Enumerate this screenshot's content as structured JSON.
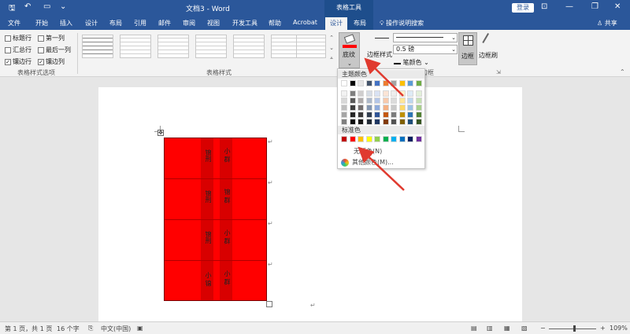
{
  "app": {
    "doc_title": "文档3 - Word",
    "context_title": "表格工具",
    "login_label": "登录",
    "share_label": "共享",
    "search_label": "操作说明搜索"
  },
  "tabs": [
    "文件",
    "开始",
    "插入",
    "设计",
    "布局",
    "引用",
    "邮件",
    "审阅",
    "视图",
    "开发工具",
    "帮助",
    "Acrobat",
    "设计",
    "布局"
  ],
  "style_options": {
    "header_row": "标题行",
    "first_col": "第一列",
    "total_row": "汇总行",
    "last_col": "最后一列",
    "banded_rows": "镶边行",
    "banded_cols": "镶边列",
    "group_label": "表格样式选项"
  },
  "table_styles": {
    "group_label": "表格样式"
  },
  "shading": {
    "label": "底纹",
    "color": "#ff0000"
  },
  "borders": {
    "border_styles_label": "边框样式",
    "line_weight": "0.5 磅",
    "pen_color_label": "笔颜色",
    "border_label": "边框",
    "painter_label": "边框刷",
    "group_label": "边框"
  },
  "color_picker": {
    "theme_header": "主题颜色",
    "theme_top": [
      "#ffffff",
      "#000000",
      "#e7e6e6",
      "#44546a",
      "#4472c4",
      "#ed7d31",
      "#a5a5a5",
      "#ffc000",
      "#5b9bd5",
      "#70ad47"
    ],
    "theme_shades": [
      [
        "#f2f2f2",
        "#7f7f7f",
        "#d0cece",
        "#d6dce4",
        "#d9e2f3",
        "#fbe4d5",
        "#ededed",
        "#fff2cc",
        "#deebf6",
        "#e2efd9"
      ],
      [
        "#d8d8d8",
        "#595959",
        "#aeaaaa",
        "#adb9ca",
        "#b4c6e7",
        "#f7caac",
        "#dbdbdb",
        "#fee599",
        "#bdd7ee",
        "#c5e0b3"
      ],
      [
        "#bfbfbf",
        "#3f3f3f",
        "#757070",
        "#8496b0",
        "#8eaadb",
        "#f4b083",
        "#c9c9c9",
        "#ffd965",
        "#9cc3e5",
        "#a8d08d"
      ],
      [
        "#a5a5a5",
        "#262626",
        "#3a3838",
        "#323e4f",
        "#2f5496",
        "#c45911",
        "#7b7b7b",
        "#bf9000",
        "#2e75b5",
        "#538135"
      ],
      [
        "#7f7f7f",
        "#0c0c0c",
        "#171616",
        "#222a35",
        "#1f3763",
        "#823b0b",
        "#525252",
        "#7f6000",
        "#1e4e79",
        "#375623"
      ]
    ],
    "standard_header": "标准色",
    "standard": [
      "#c00000",
      "#ff0000",
      "#ffc000",
      "#ffff00",
      "#92d050",
      "#00b050",
      "#00b0f0",
      "#0070c0",
      "#002060",
      "#7030a0"
    ],
    "no_color": "无颜色(N)",
    "more_colors": "其他颜色(M)..."
  },
  "table": {
    "cells": [
      [
        "锦刑",
        "小 群"
      ],
      [
        "锦刑",
        "锦 群"
      ],
      [
        "锦刑",
        "小 群"
      ],
      [
        "小 锦",
        "小 群"
      ]
    ]
  },
  "status": {
    "page": "第 1 页，共 1 页",
    "words": "16 个字",
    "language": "中文(中国)",
    "zoom": "109%"
  }
}
